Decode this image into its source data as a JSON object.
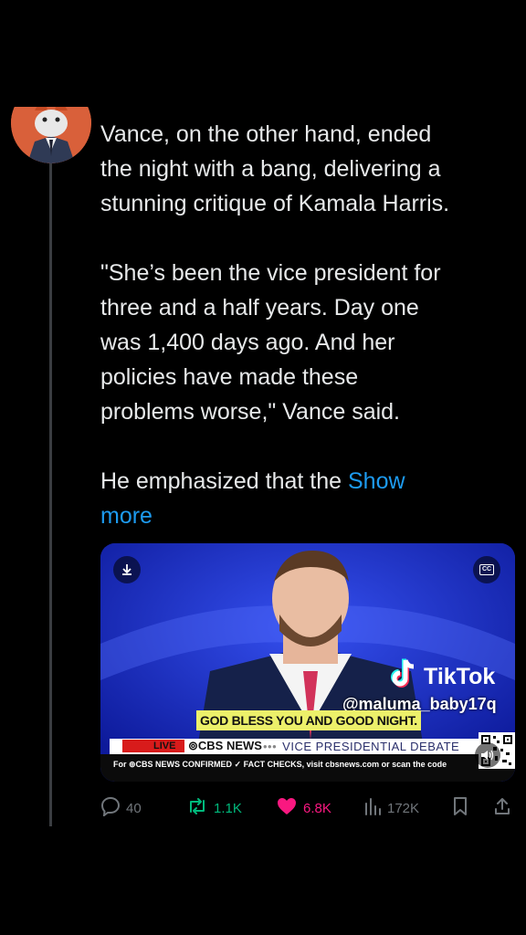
{
  "tweet": {
    "paragraphs": [
      "Vance, on the other hand, ended\nthe night with a bang, delivering a\nstunning critique of Kamala Harris.",
      "\"She’s been the vice president for\nthree and a half years. Day one\nwas 1,400 days ago. And her\npolicies have made these\nproblems worse,\" Vance said."
    ],
    "last_paragraph": "He emphasized that the ",
    "show_more": "Show\nmore"
  },
  "media": {
    "tiktok_brand": "TikTok",
    "tiktok_handle": "@maluma_baby17q",
    "caption": "GOD BLESS YOU AND GOOD NIGHT.",
    "live_label": "LIVE",
    "network": "⊚CBS NEWS",
    "dots": "•••",
    "program": "VICE PRESIDENTIAL DEBATE",
    "fact_check": "For ⊚CBS NEWS CONFIRMED ✓ FACT CHECKS, visit cbsnews.com or scan the code",
    "cc_label": "CC"
  },
  "actions": {
    "replies": "40",
    "reposts": "1.1K",
    "likes": "6.8K",
    "views": "172K"
  },
  "colors": {
    "accent": "#1d9bf0",
    "repost": "#00ba7c",
    "like": "#f91880",
    "muted": "#71767b"
  }
}
